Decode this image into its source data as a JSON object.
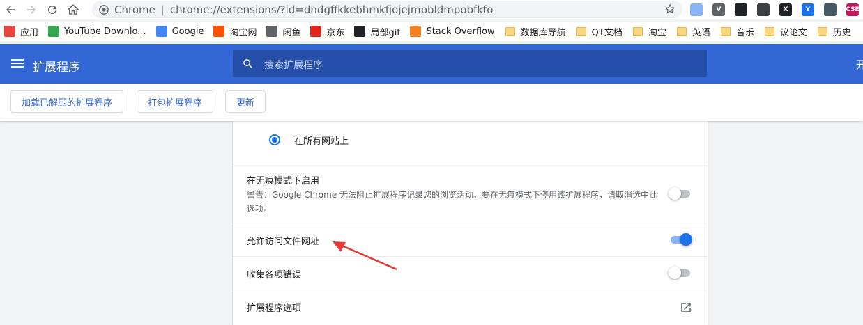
{
  "browser": {
    "omnibox": {
      "origin": "Chrome",
      "separator": "|",
      "url": "chrome://extensions/?id=dhdgffkkebhmkfjojejmpbldmpobfkfo"
    },
    "extension_icons": [
      {
        "name": "circle-ext-icon",
        "color": "#8ab4f8",
        "glyph": ""
      },
      {
        "name": "vimium-ext-icon",
        "color": "#5f6368",
        "glyph": "V"
      },
      {
        "name": "tampermonkey-ext-icon",
        "color": "#202124",
        "glyph": ""
      },
      {
        "name": "dots-ext-icon",
        "color": "#3c4043",
        "glyph": ""
      },
      {
        "name": "x-ext-icon",
        "color": "#202124",
        "glyph": "X"
      },
      {
        "name": "shield-ext-icon",
        "color": "#1a73e8",
        "glyph": "Y"
      },
      {
        "name": "books-ext-icon",
        "color": "#455a64",
        "glyph": ""
      },
      {
        "name": "csdn-ext-icon",
        "color": "#c2185b",
        "glyph": "CSE"
      }
    ]
  },
  "bookmarks": [
    {
      "label": "应用",
      "icon": "apps-icon",
      "color": "#e8453c"
    },
    {
      "label": "YouTube Downlo...",
      "icon": "download-arrow-icon",
      "color": "#34a853"
    },
    {
      "label": "Google",
      "icon": "google-icon",
      "color": "#4285f4"
    },
    {
      "label": "淘宝网",
      "icon": "taobao-icon",
      "color": "#ff5000"
    },
    {
      "label": "闲鱼",
      "icon": "globe-icon",
      "color": "#5f6368"
    },
    {
      "label": "京东",
      "icon": "jd-icon",
      "color": "#e1251b"
    },
    {
      "label": "局部git",
      "icon": "github-icon",
      "color": "#202124"
    },
    {
      "label": "Stack Overflow",
      "icon": "stackoverflow-icon",
      "color": "#f48024"
    },
    {
      "label": "数据库导航",
      "icon": "folder-icon",
      "color": ""
    },
    {
      "label": "QT文档",
      "icon": "folder-icon",
      "color": ""
    },
    {
      "label": "淘宝",
      "icon": "folder-icon",
      "color": ""
    },
    {
      "label": "英语",
      "icon": "folder-icon",
      "color": ""
    },
    {
      "label": "音乐",
      "icon": "folder-icon",
      "color": ""
    },
    {
      "label": "议论文",
      "icon": "folder-icon",
      "color": ""
    },
    {
      "label": "历史",
      "icon": "folder-icon",
      "color": ""
    }
  ],
  "header": {
    "title": "扩展程序",
    "search_placeholder": "搜索扩展程序",
    "devmode_label": "开"
  },
  "actions": {
    "load_unpacked": "加载已解压的扩展程序",
    "pack": "打包扩展程序",
    "update": "更新"
  },
  "details": {
    "site_access_option": "在所有网站上",
    "incognito": {
      "title": "在无痕模式下启用",
      "warning": "警告：Google Chrome 无法阻止扩展程序记录您的浏览活动。要在无痕模式下停用该扩展程序，请取消选中此选项。",
      "enabled": false
    },
    "file_urls": {
      "title": "允许访问文件网址",
      "enabled": true
    },
    "collect_errors": {
      "title": "收集各项错误",
      "enabled": false
    },
    "options": {
      "title": "扩展程序选项"
    }
  },
  "colors": {
    "header_blue": "#3367d6",
    "search_bg": "#254fa8",
    "accent": "#1a73e8",
    "annotation_arrow": "#e53935"
  }
}
